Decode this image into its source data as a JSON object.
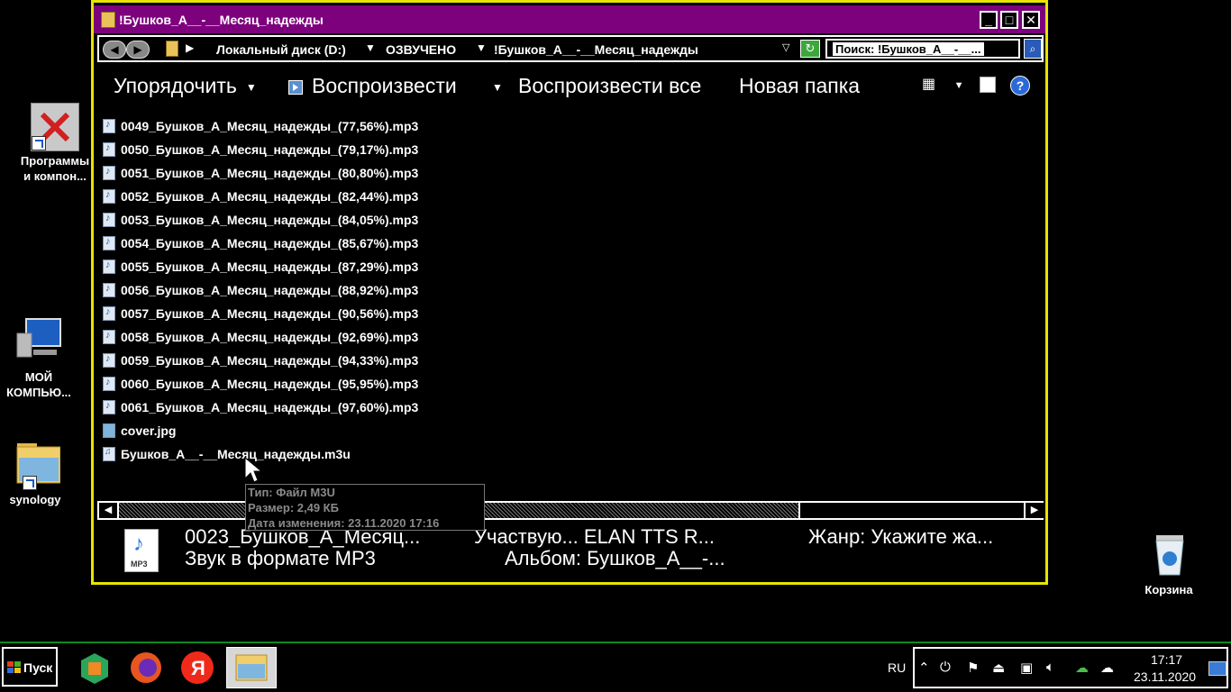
{
  "desktop": {
    "icons": [
      {
        "label_line1": "Программы",
        "label_line2": "и компон..."
      },
      {
        "label_line1": "МОЙ",
        "label_line2": "КОМПЬЮ..."
      },
      {
        "label_line1": "synology",
        "label_line2": ""
      },
      {
        "label_line1": "Корзина",
        "label_line2": ""
      }
    ]
  },
  "window": {
    "title": "!Бушков_А__-__Месяц_надежды",
    "address": {
      "crumbs": [
        "Локальный диск (D:)",
        "ОЗВУЧЕНО",
        "!Бушков_А__-__Месяц_надежды"
      ],
      "search_placeholder": "Поиск: !Бушков_А__-__..."
    },
    "toolbar": {
      "organize": "Упорядочить",
      "play": "Воспроизвести",
      "play_all": "Воспроизвести все",
      "new_folder": "Новая папка"
    },
    "files": [
      {
        "name": "0049_Бушков_А_Месяц_надежды_(77,56%).mp3",
        "icon": "mp3-file-icon"
      },
      {
        "name": "0050_Бушков_А_Месяц_надежды_(79,17%).mp3",
        "icon": "mp3-file-icon"
      },
      {
        "name": "0051_Бушков_А_Месяц_надежды_(80,80%).mp3",
        "icon": "mp3-file-icon"
      },
      {
        "name": "0052_Бушков_А_Месяц_надежды_(82,44%).mp3",
        "icon": "mp3-file-icon"
      },
      {
        "name": "0053_Бушков_А_Месяц_надежды_(84,05%).mp3",
        "icon": "mp3-file-icon"
      },
      {
        "name": "0054_Бушков_А_Месяц_надежды_(85,67%).mp3",
        "icon": "mp3-file-icon"
      },
      {
        "name": "0055_Бушков_А_Месяц_надежды_(87,29%).mp3",
        "icon": "mp3-file-icon"
      },
      {
        "name": "0056_Бушков_А_Месяц_надежды_(88,92%).mp3",
        "icon": "mp3-file-icon"
      },
      {
        "name": "0057_Бушков_А_Месяц_надежды_(90,56%).mp3",
        "icon": "mp3-file-icon"
      },
      {
        "name": "0058_Бушков_А_Месяц_надежды_(92,69%).mp3",
        "icon": "mp3-file-icon"
      },
      {
        "name": "0059_Бушков_А_Месяц_надежды_(94,33%).mp3",
        "icon": "mp3-file-icon"
      },
      {
        "name": "0060_Бушков_А_Месяц_надежды_(95,95%).mp3",
        "icon": "mp3-file-icon"
      },
      {
        "name": "0061_Бушков_А_Месяц_надежды_(97,60%).mp3",
        "icon": "mp3-file-icon"
      },
      {
        "name": "cover.jpg",
        "icon": "jpg-file-icon"
      },
      {
        "name": "Бушков_А__-__Месяц_надежды.m3u",
        "icon": "m3u-file-icon"
      }
    ],
    "tooltip": {
      "type": "Тип: Файл M3U",
      "size": "Размер: 2,49 КБ",
      "modified": "Дата изменения: 23.11.2020 17:16"
    },
    "details": {
      "filename": "0023_Бушков_А_Месяц...",
      "filetype": "Звук в формате MP3",
      "artist": "Участвую... ELAN TTS R...",
      "album": "Альбом: Бушков_А__-...",
      "genre": "Жанр: Укажите жа...",
      "icon_label": "MP3"
    }
  },
  "taskbar": {
    "start_label": "Пуск",
    "language": "RU",
    "time": "17:17",
    "date": "23.11.2020"
  },
  "colors": {
    "titlebar": "#7d017d",
    "window_border": "#e8e400",
    "taskbar_border": "#0c8a24"
  }
}
